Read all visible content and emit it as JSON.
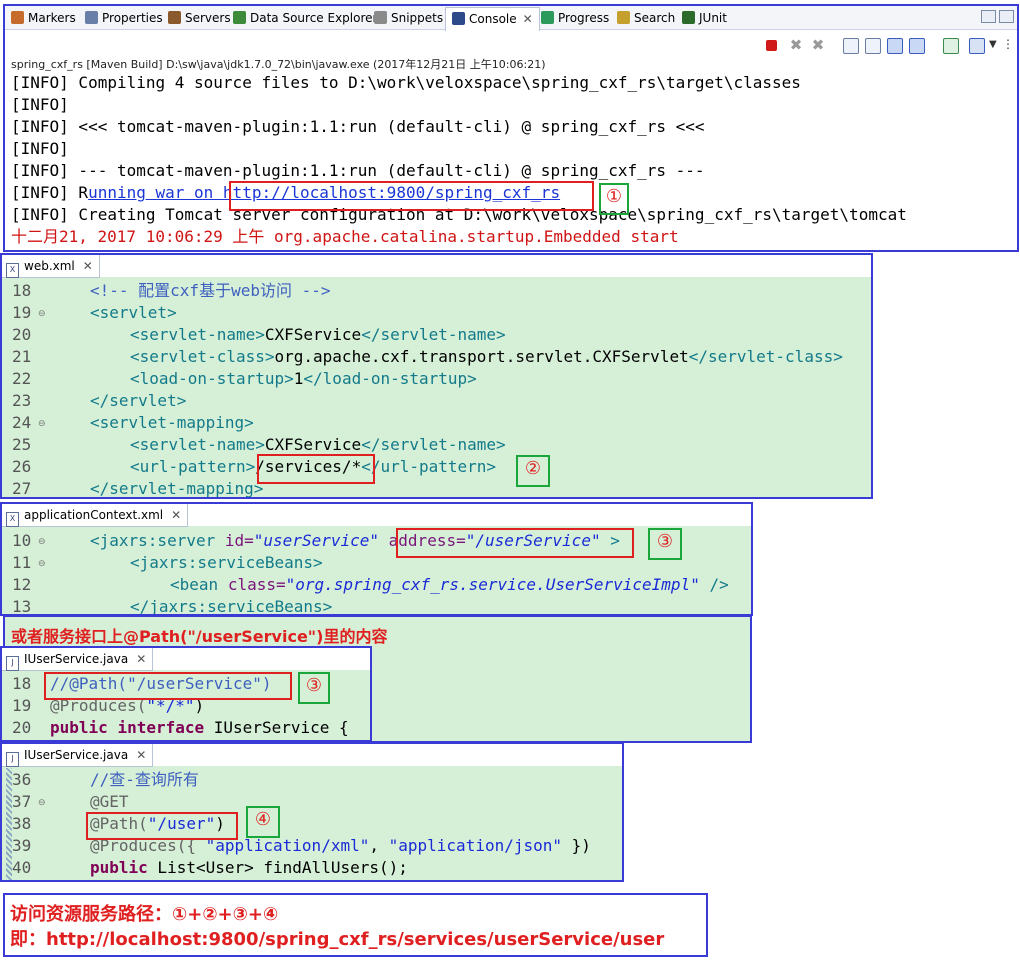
{
  "tabs": [
    {
      "label": "Markers",
      "icon": "markers-icon",
      "color": "#c66b2c"
    },
    {
      "label": "Properties",
      "icon": "properties-icon",
      "color": "#6a7fa8"
    },
    {
      "label": "Servers",
      "icon": "servers-icon",
      "color": "#8a5a2c"
    },
    {
      "label": "Data Source Explorer",
      "icon": "data-source-icon",
      "color": "#3c8a3a"
    },
    {
      "label": "Snippets",
      "icon": "snippets-icon",
      "color": "#8a8a8a"
    },
    {
      "label": "Console",
      "icon": "console-icon",
      "color": "#2c4a8a",
      "active": true
    },
    {
      "label": "Progress",
      "icon": "progress-icon",
      "color": "#2c9a5a"
    },
    {
      "label": "Search",
      "icon": "search-icon",
      "color": "#c6a02c"
    },
    {
      "label": "JUnit",
      "icon": "junit-icon",
      "color": "#2c6a2c"
    }
  ],
  "console": {
    "title": "spring_cxf_rs [Maven Build] D:\\sw\\java\\jdk1.7.0_72\\bin\\javaw.exe (2017年12月21日 上午10:06:21)",
    "lines": [
      {
        "text": "[INFO] Compiling 4 source files to D:\\work\\veloxspace\\spring_cxf_rs\\target\\classes"
      },
      {
        "text": "[INFO]"
      },
      {
        "text": "[INFO] <<< tomcat-maven-plugin:1.1:run (default-cli) @ spring_cxf_rs <<<"
      },
      {
        "text": "[INFO]"
      },
      {
        "text": "[INFO] --- tomcat-maven-plugin:1.1:run (default-cli) @ spring_cxf_rs ---"
      },
      {
        "text": "[INFO] Creating Tomcat server configuration at D:\\work\\veloxspace\\spring_cxf_rs\\target\\tomcat"
      },
      {
        "text": "十二月21, 2017 10:06:29 上午 org.apache.catalina.startup.Embedded start"
      }
    ],
    "running_prefix": "[INFO] R",
    "running_mid": "unning war on ",
    "running_url": "http://localhost:9800/spring_cxf_rs",
    "marker_1": "①"
  },
  "web_xml": {
    "tab": "web.xml",
    "line_numbers": [
      "18",
      "19",
      "20",
      "21",
      "22",
      "23",
      "24",
      "25",
      "26",
      "27"
    ],
    "comment": "<!-- 配置cxf基于web访问 -->",
    "servlet_open": "<servlet>",
    "servlet_name_open": "<servlet-name>",
    "servlet_name_value": "CXFService",
    "servlet_name_close": "</servlet-name>",
    "servlet_class_open": "<servlet-class>",
    "servlet_class_value": "org.apache.cxf.transport.servlet.CXFServlet",
    "servlet_class_close": "</servlet-class>",
    "load_open": "<load-on-startup>",
    "load_value": "1",
    "load_close": "</load-on-startup>",
    "servlet_close": "</servlet>",
    "mapping_open": "<servlet-mapping>",
    "url_open": "<url-pattern>",
    "url_value": "/services/*",
    "url_close": "</url-pattern>",
    "mapping_close": "</servlet-mapping>",
    "marker_2": "②"
  },
  "app_ctx": {
    "tab": "applicationContext.xml",
    "line_numbers": [
      "10",
      "11",
      "12",
      "13"
    ],
    "server_tag": "<jaxrs:server",
    "id_attr": "id=",
    "id_value": "\"userService\"",
    "address_attr": "address=",
    "address_value": "\"/userService\"",
    "close_bracket": ">",
    "beans_open": "<jaxrs:serviceBeans>",
    "bean_tag": "<bean",
    "class_attr": "class=",
    "class_value": "\"org.spring_cxf_rs.service.UserServiceImpl\"",
    "bean_end": "/>",
    "beans_close": "</jaxrs:serviceBeans>",
    "marker_3": "③"
  },
  "hint": {
    "text": "或者服务接口上@Path(\"/userService\")里的内容"
  },
  "iuser_1": {
    "tab": "IUserService.java",
    "line_numbers": [
      "18",
      "19",
      "20"
    ],
    "line18": "//@Path(\"/userService\")",
    "produces": "@Produces(",
    "produces_value": "\"*/*\"",
    "produces_close": ")",
    "kw_public": "public",
    "kw_interface": "interface",
    "iface_rest": "IUserService {",
    "marker_3": "③"
  },
  "iuser_2": {
    "tab": "IUserService.java",
    "line_numbers": [
      "36",
      "37",
      "38",
      "39",
      "40"
    ],
    "comment": "//查-查询所有",
    "get": "@GET",
    "path_ann": "@Path(",
    "path_value": "\"/user\"",
    "path_close": ")",
    "produces": "@Produces({ ",
    "prod_v1": "\"application/xml\"",
    "prod_comma": ", ",
    "prod_v2": "\"application/json\"",
    "prod_close": " })",
    "kw_public": "public",
    "method_rest": " List<User> findAllUsers();",
    "marker_4": "④"
  },
  "summary": {
    "line1": "访问资源服务路径：①+②+③+④",
    "line2": "即：http://localhost:9800/spring_cxf_rs/services/userService/user"
  }
}
